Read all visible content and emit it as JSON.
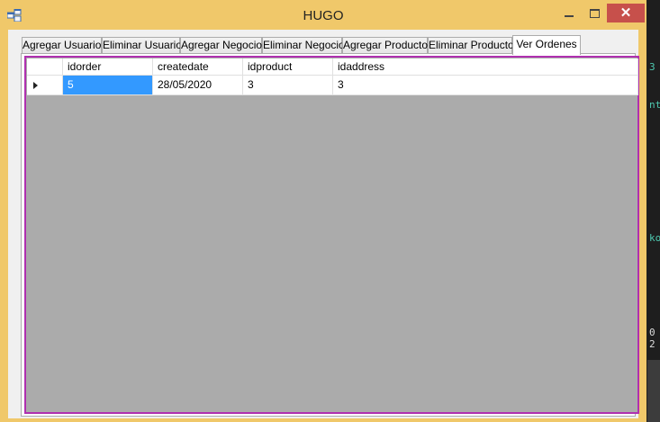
{
  "window": {
    "title": "HUGO",
    "close_glyph": "✕"
  },
  "tabs": [
    {
      "label": "Agregar Usuario",
      "active": false
    },
    {
      "label": "Eliminar Usuario",
      "active": false
    },
    {
      "label": "Agregar Negocio",
      "active": false
    },
    {
      "label": "Eliminar Negocio",
      "active": false
    },
    {
      "label": "Agregar Producto",
      "active": false
    },
    {
      "label": "Eliminar Producto",
      "active": false
    },
    {
      "label": "Ver Ordenes",
      "active": true
    }
  ],
  "grid": {
    "columns": [
      "idorder",
      "createdate",
      "idproduct",
      "idaddress"
    ],
    "rows": [
      [
        "5",
        "28/05/2020",
        "3",
        "3"
      ]
    ],
    "selected_cell": [
      0,
      0
    ]
  },
  "background_code": [
    "3",
    "nt",
    "ko",
    "0 2"
  ],
  "colors": {
    "window_frame": "#f0c86a",
    "close_button": "#c7504b",
    "grid_border": "#b030b0",
    "grid_background": "#ababab",
    "selection": "#3399ff"
  }
}
